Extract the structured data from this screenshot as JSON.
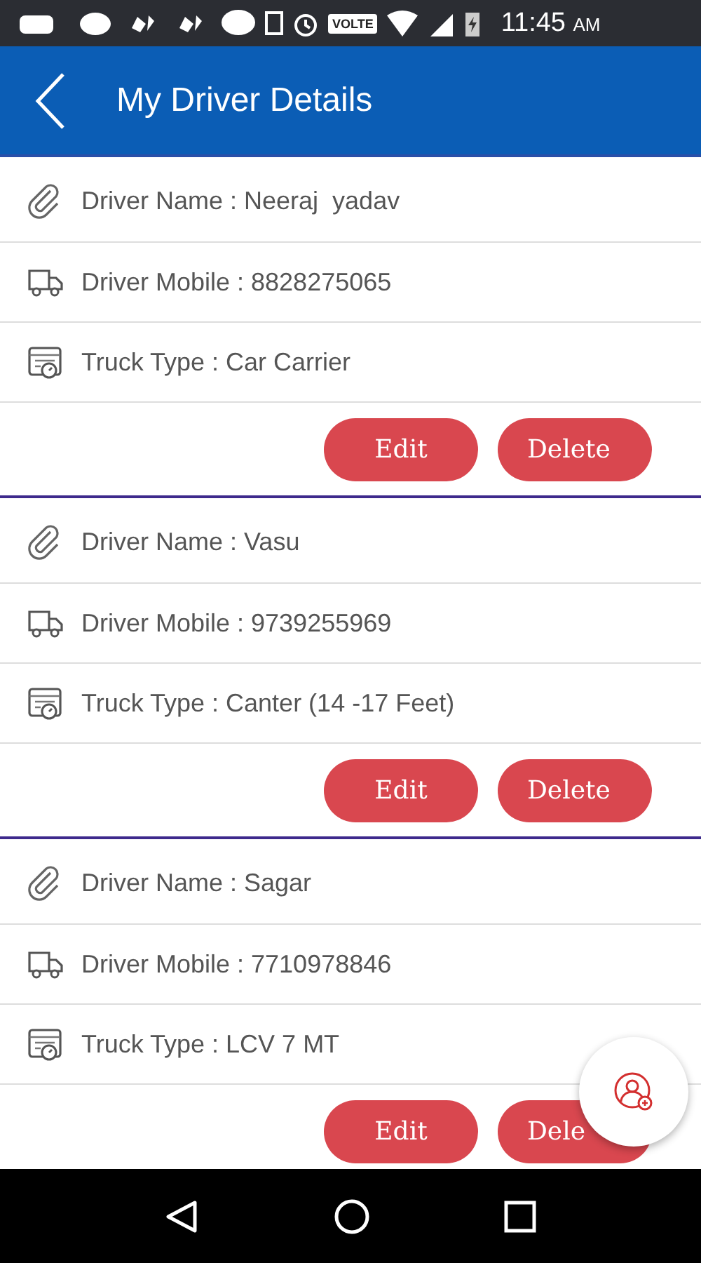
{
  "status_bar": {
    "time": "11:45",
    "meridiem": "AM",
    "volte": "VOLTE"
  },
  "app_bar": {
    "title": "My Driver Details"
  },
  "drivers": [
    {
      "name_row": "Driver Name : Neeraj  yadav",
      "mobile_row": "Driver Mobile : 8828275065",
      "truck_row": "Truck Type : Car Carrier",
      "edit": "Edit",
      "delete": "Delete"
    },
    {
      "name_row": "Driver Name : Vasu",
      "mobile_row": "Driver Mobile : 9739255969",
      "truck_row": "Truck Type : Canter (14 -17 Feet)",
      "edit": "Edit",
      "delete": "Delete"
    },
    {
      "name_row": "Driver Name : Sagar",
      "mobile_row": "Driver Mobile : 7710978846",
      "truck_row": "Truck Type : LCV 7 MT",
      "edit": "Edit",
      "delete": "Dele"
    }
  ]
}
